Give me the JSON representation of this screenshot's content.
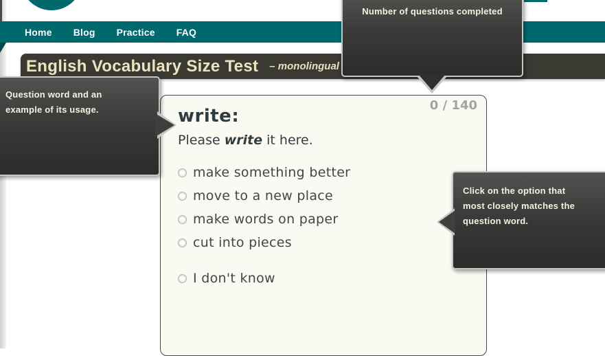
{
  "colors": {
    "teal_accent": "#00696d",
    "teal_fold": "#014a4e",
    "header_bg": "#3a3932",
    "title_text": "#ebe4c1",
    "tooltip_border": "#c6c6c6",
    "tooltip_text": "#f5f0e1",
    "card_bg": "#faf9f2",
    "card_border": "#46484a",
    "question_text": "#2f3b40",
    "option_text": "#3d4849",
    "progress_text": "#a3a3a1"
  },
  "nav": {
    "items": [
      "Home",
      "Blog",
      "Practice",
      "FAQ"
    ]
  },
  "header": {
    "title": "English Vocabulary Size Test",
    "subtitle": "– monolingual"
  },
  "question": {
    "progress": "0 / 140",
    "word": "write:",
    "example": {
      "prefix": "Please ",
      "emphasis": "write",
      "suffix": " it here."
    },
    "options": [
      "make something better",
      "move to a new place",
      "make words on paper",
      "cut into pieces"
    ],
    "unknown_option": "I don't know"
  },
  "tooltips": {
    "progress": {
      "lines": [
        "Number of questions completed"
      ]
    },
    "question": {
      "lines": [
        "Question word and an",
        "example of its usage."
      ]
    },
    "options": {
      "lines": [
        "Click on the option that",
        "most closely matches the",
        "question word."
      ]
    }
  },
  "icons": {
    "logo": "teal-circle-logo",
    "radio": "radio-button-unselected"
  }
}
